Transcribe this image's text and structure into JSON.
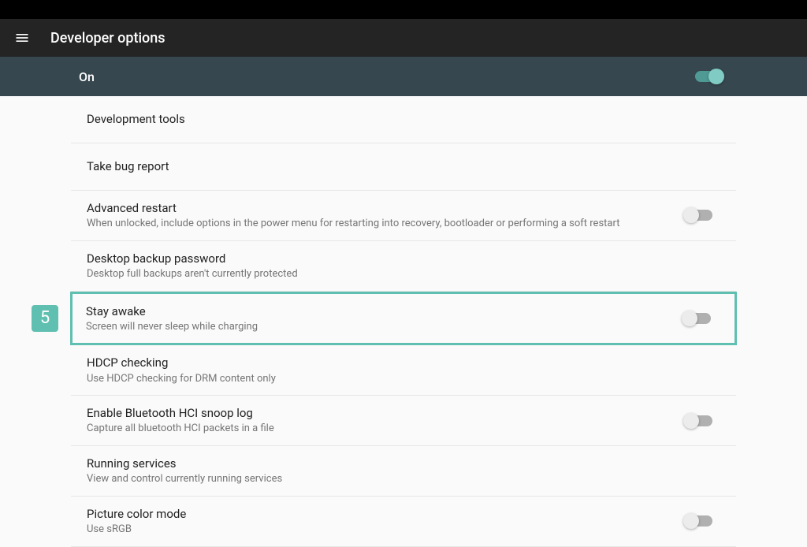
{
  "header": {
    "title": "Developer options"
  },
  "master": {
    "label": "On",
    "state": "on"
  },
  "callout": {
    "step": "5"
  },
  "rows": [
    {
      "key": "dev-tools",
      "title": "Development tools",
      "sub": "",
      "toggle": null
    },
    {
      "key": "bug-report",
      "title": "Take bug report",
      "sub": "",
      "toggle": null
    },
    {
      "key": "advanced-restart",
      "title": "Advanced restart",
      "sub": "When unlocked, include options in the power menu for restarting into recovery, bootloader or performing a soft restart",
      "toggle": "off"
    },
    {
      "key": "desktop-backup",
      "title": "Desktop backup password",
      "sub": "Desktop full backups aren't currently protected",
      "toggle": null
    },
    {
      "key": "stay-awake",
      "title": "Stay awake",
      "sub": "Screen will never sleep while charging",
      "toggle": "off",
      "highlighted": true
    },
    {
      "key": "hdcp",
      "title": "HDCP checking",
      "sub": "Use HDCP checking for DRM content only",
      "toggle": null
    },
    {
      "key": "bt-hci",
      "title": "Enable Bluetooth HCI snoop log",
      "sub": "Capture all bluetooth HCI packets in a file",
      "toggle": "off"
    },
    {
      "key": "running-services",
      "title": "Running services",
      "sub": "View and control currently running services",
      "toggle": null
    },
    {
      "key": "picture-color",
      "title": "Picture color mode",
      "sub": "Use sRGB",
      "toggle": "off"
    }
  ]
}
